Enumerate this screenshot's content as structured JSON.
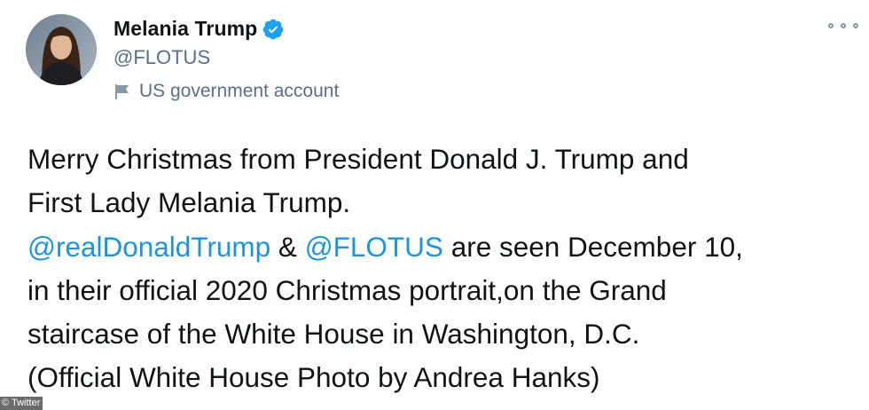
{
  "profile": {
    "name": "Melania Trump",
    "handle": "@FLOTUS",
    "label": "US government account",
    "verified_color": "#1da1f2"
  },
  "tweet": {
    "line1": "Merry Christmas from President Donald J. Trump and",
    "line2": "First Lady Melania Trump.",
    "mention1": "@realDonaldTrump",
    "amp": " & ",
    "mention2": "@FLOTUS",
    "line3_rest": " are seen December 10,",
    "line4": "in their official 2020 Christmas portrait,on the Grand",
    "line5": "staircase of the White House in Washington, D.C.",
    "line6": "(Official White House Photo by Andrea Hanks)"
  },
  "credit": "© Twitter",
  "colors": {
    "link": "#1b95e0",
    "secondary_text": "#5b7083",
    "text": "#0f1419"
  },
  "icons": [
    "verified-badge-icon",
    "government-flag-icon",
    "more-options-icon"
  ]
}
